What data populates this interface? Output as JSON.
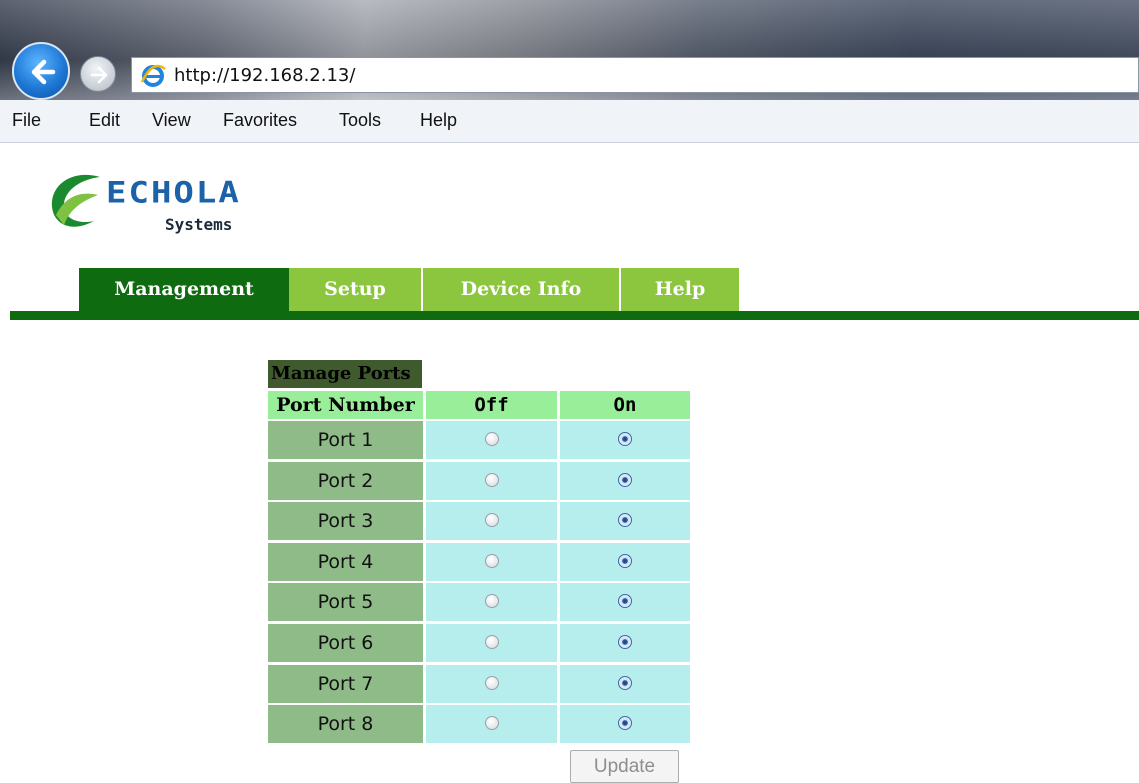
{
  "browser": {
    "address": "http://192.168.2.13/",
    "menu": [
      "File",
      "Edit",
      "View",
      "Favorites",
      "Tools",
      "Help"
    ]
  },
  "logo": {
    "name": "ECHOLA",
    "sub": "Systems"
  },
  "nav": {
    "tabs": [
      {
        "label": "Management",
        "active": true
      },
      {
        "label": "Setup",
        "active": false
      },
      {
        "label": "Device Info",
        "active": false
      },
      {
        "label": "Help",
        "active": false
      }
    ]
  },
  "ports": {
    "caption": "Manage Ports",
    "headers": {
      "port": "Port Number",
      "off": "Off",
      "on": "On"
    },
    "rows": [
      {
        "label": "Port 1",
        "state": "on"
      },
      {
        "label": "Port 2",
        "state": "on"
      },
      {
        "label": "Port 3",
        "state": "on"
      },
      {
        "label": "Port 4",
        "state": "on"
      },
      {
        "label": "Port 5",
        "state": "on"
      },
      {
        "label": "Port 6",
        "state": "on"
      },
      {
        "label": "Port 7",
        "state": "on"
      },
      {
        "label": "Port 8",
        "state": "on"
      }
    ],
    "update_label": "Update"
  },
  "colors": {
    "tab_active": "#0f6b0f",
    "tab_inactive": "#8cc63e",
    "header": "#99ee99",
    "port_cell": "#8fbb88",
    "radio_cell": "#b6eeee"
  }
}
